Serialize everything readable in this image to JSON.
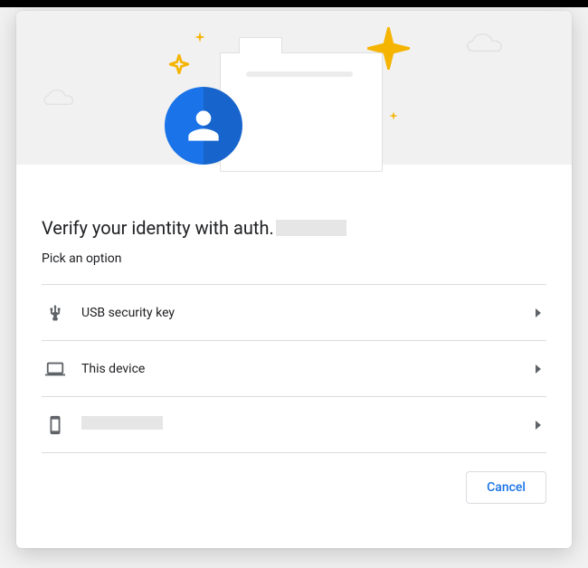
{
  "header": {
    "title_prefix": "Verify your identity with auth.",
    "title_redacted": true,
    "subtitle": "Pick an option"
  },
  "options": [
    {
      "icon": "usb-icon",
      "label": "USB security key",
      "redacted": false
    },
    {
      "icon": "laptop-icon",
      "label": "This device",
      "redacted": false
    },
    {
      "icon": "phone-icon",
      "label": "",
      "redacted": true
    }
  ],
  "footer": {
    "cancel_label": "Cancel"
  }
}
